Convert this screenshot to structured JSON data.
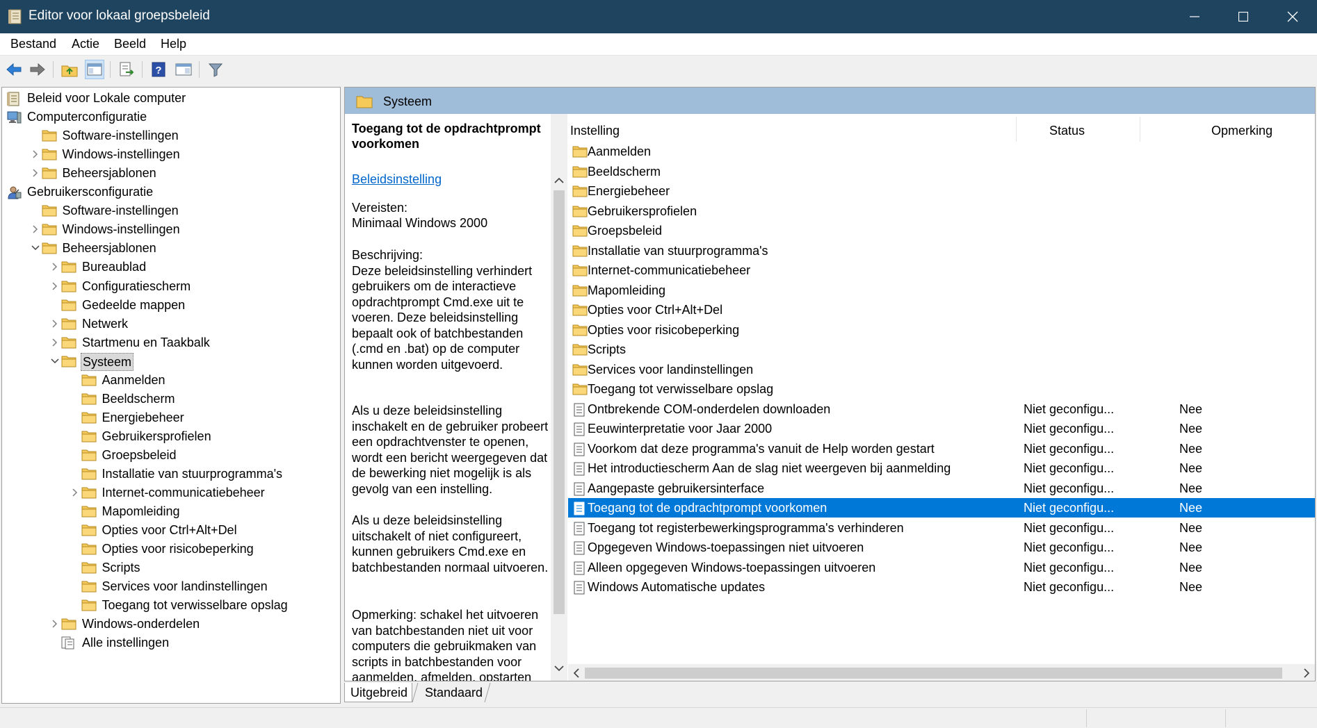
{
  "window": {
    "title": "Editor voor lokaal groepsbeleid",
    "minimize_label": "minimize",
    "maximize_label": "maximize",
    "close_label": "close"
  },
  "menu": [
    "Bestand",
    "Actie",
    "Beeld",
    "Help"
  ],
  "toolbar": [
    "back-arrow-icon",
    "forward-arrow-icon",
    "up-folder-icon",
    "show-hide-tree-icon",
    "export-list-icon",
    "help-icon",
    "properties-view-icon",
    "filter-icon"
  ],
  "tree": [
    {
      "label": "Beleid voor Lokale computer",
      "level": 0,
      "chevron": "none",
      "icon": "policy"
    },
    {
      "label": "Computerconfiguratie",
      "level": 0,
      "chevron": "down",
      "icon": "computer"
    },
    {
      "label": "Software-instellingen",
      "level": 1,
      "chevron": "none",
      "icon": "folder"
    },
    {
      "label": "Windows-instellingen",
      "level": 1,
      "chevron": "right",
      "icon": "folder"
    },
    {
      "label": "Beheersjablonen",
      "level": 1,
      "chevron": "right",
      "icon": "folder"
    },
    {
      "label": "Gebruikersconfiguratie",
      "level": 0,
      "chevron": "down",
      "icon": "user"
    },
    {
      "label": "Software-instellingen",
      "level": 1,
      "chevron": "none",
      "icon": "folder"
    },
    {
      "label": "Windows-instellingen",
      "level": 1,
      "chevron": "right",
      "icon": "folder"
    },
    {
      "label": "Beheersjablonen",
      "level": 1,
      "chevron": "down",
      "icon": "folder"
    },
    {
      "label": "Bureaublad",
      "level": 2,
      "chevron": "right",
      "icon": "folder"
    },
    {
      "label": "Configuratiescherm",
      "level": 2,
      "chevron": "right",
      "icon": "folder"
    },
    {
      "label": "Gedeelde mappen",
      "level": 2,
      "chevron": "none",
      "icon": "folder"
    },
    {
      "label": "Netwerk",
      "level": 2,
      "chevron": "right",
      "icon": "folder"
    },
    {
      "label": "Startmenu en Taakbalk",
      "level": 2,
      "chevron": "right",
      "icon": "folder"
    },
    {
      "label": "Systeem",
      "level": 2,
      "chevron": "down",
      "icon": "folder",
      "selected": true
    },
    {
      "label": "Aanmelden",
      "level": 3,
      "chevron": "none",
      "icon": "folder"
    },
    {
      "label": "Beeldscherm",
      "level": 3,
      "chevron": "none",
      "icon": "folder"
    },
    {
      "label": "Energiebeheer",
      "level": 3,
      "chevron": "none",
      "icon": "folder"
    },
    {
      "label": "Gebruikersprofielen",
      "level": 3,
      "chevron": "none",
      "icon": "folder"
    },
    {
      "label": "Groepsbeleid",
      "level": 3,
      "chevron": "none",
      "icon": "folder"
    },
    {
      "label": "Installatie van stuurprogramma's",
      "level": 3,
      "chevron": "none",
      "icon": "folder"
    },
    {
      "label": "Internet-communicatiebeheer",
      "level": 3,
      "chevron": "right",
      "icon": "folder"
    },
    {
      "label": "Mapomleiding",
      "level": 3,
      "chevron": "none",
      "icon": "folder"
    },
    {
      "label": "Opties voor Ctrl+Alt+Del",
      "level": 3,
      "chevron": "none",
      "icon": "folder"
    },
    {
      "label": "Opties voor risicobeperking",
      "level": 3,
      "chevron": "none",
      "icon": "folder"
    },
    {
      "label": "Scripts",
      "level": 3,
      "chevron": "none",
      "icon": "folder"
    },
    {
      "label": "Services voor landinstellingen",
      "level": 3,
      "chevron": "none",
      "icon": "folder"
    },
    {
      "label": "Toegang tot verwisselbare opslag",
      "level": 3,
      "chevron": "none",
      "icon": "folder"
    },
    {
      "label": "Windows-onderdelen",
      "level": 2,
      "chevron": "right",
      "icon": "folder"
    },
    {
      "label": "Alle instellingen",
      "level": 2,
      "chevron": "none",
      "icon": "settings"
    }
  ],
  "right_header": {
    "title": "Systeem"
  },
  "description": {
    "title": "Toegang tot de opdrachtprompt voorkomen",
    "link": "Beleidsinstelling",
    "requirements_label": "Vereisten:",
    "requirements_value": "Minimaal Windows 2000",
    "paragraphs": [
      "Beschrijving:\nDeze beleidsinstelling verhindert gebruikers om de interactieve opdrachtprompt Cmd.exe uit te voeren.  Deze beleidsinstelling bepaalt ook of batchbestanden (.cmd en .bat) op de computer kunnen worden uitgevoerd.",
      "Als u deze beleidsinstelling inschakelt en de gebruiker probeert een opdrachtvenster te openen, wordt een bericht weergegeven dat de bewerking niet mogelijk is als gevolg van een instelling.",
      "Als u deze beleidsinstelling uitschakelt of niet configureert, kunnen gebruikers Cmd.exe en batchbestanden normaal uitvoeren.",
      "Opmerking: schakel het uitvoeren van batchbestanden niet uit voor computers die gebruikmaken van scripts in batchbestanden voor aanmelden, afmelden, opstarten"
    ]
  },
  "columns": {
    "setting": "Instelling",
    "state": "Status",
    "comment": "Opmerking"
  },
  "folders": [
    "Aanmelden",
    "Beeldscherm",
    "Energiebeheer",
    "Gebruikersprofielen",
    "Groepsbeleid",
    "Installatie van stuurprogramma's",
    "Internet-communicatiebeheer",
    "Mapomleiding",
    "Opties voor Ctrl+Alt+Del",
    "Opties voor risicobeperking",
    "Scripts",
    "Services voor landinstellingen",
    "Toegang tot verwisselbare opslag"
  ],
  "settings": [
    {
      "name": "Ontbrekende COM-onderdelen downloaden",
      "state": "Niet geconfigu...",
      "comment": "Nee"
    },
    {
      "name": "Eeuwinterpretatie voor Jaar 2000",
      "state": "Niet geconfigu...",
      "comment": "Nee"
    },
    {
      "name": "Voorkom dat deze programma's vanuit de Help worden gestart",
      "state": "Niet geconfigu...",
      "comment": "Nee"
    },
    {
      "name": "Het introductiescherm Aan de slag niet weergeven bij aanmelding",
      "state": "Niet geconfigu...",
      "comment": "Nee"
    },
    {
      "name": "Aangepaste gebruikersinterface",
      "state": "Niet geconfigu...",
      "comment": "Nee"
    },
    {
      "name": "Toegang tot de opdrachtprompt voorkomen",
      "state": "Niet geconfigu...",
      "comment": "Nee",
      "selected": true
    },
    {
      "name": "Toegang tot registerbewerkingsprogramma's verhinderen",
      "state": "Niet geconfigu...",
      "comment": "Nee"
    },
    {
      "name": "Opgegeven Windows-toepassingen niet uitvoeren",
      "state": "Niet geconfigu...",
      "comment": "Nee"
    },
    {
      "name": "Alleen opgegeven Windows-toepassingen uitvoeren",
      "state": "Niet geconfigu...",
      "comment": "Nee"
    },
    {
      "name": "Windows Automatische updates",
      "state": "Niet geconfigu...",
      "comment": "Nee"
    }
  ],
  "tabs": [
    "Uitgebreid",
    "Standaard"
  ],
  "colors": {
    "titlebar": "#1f4460",
    "header": "#9fbcd8",
    "selection": "#0078d7",
    "link": "#0066cc",
    "folder": "#f5c95a"
  }
}
